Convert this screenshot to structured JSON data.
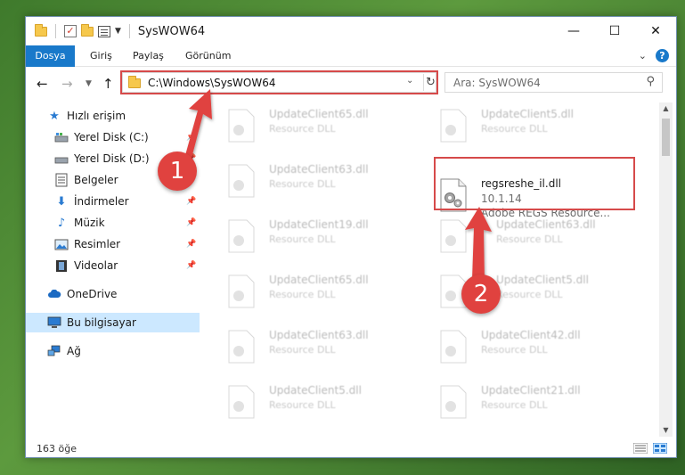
{
  "window": {
    "title": "SysWOW64",
    "buttons": {
      "minimize": "—",
      "maximize": "☐",
      "close": "✕"
    }
  },
  "ribbon": {
    "tabs": [
      "Dosya",
      "Giriş",
      "Paylaş",
      "Görünüm"
    ],
    "accent": "#1979ca"
  },
  "address": {
    "path": "C:\\Windows\\SysWOW64",
    "search_placeholder": "Ara: SysWOW64"
  },
  "nav": {
    "items": [
      {
        "label": "Hızlı erişim",
        "icon": "star-icon",
        "pinned": false
      },
      {
        "label": "Yerel Disk (C:)",
        "icon": "drive-icon",
        "pinned": true
      },
      {
        "label": "Yerel Disk (D:)",
        "icon": "drive-icon",
        "pinned": true
      },
      {
        "label": "Belgeler",
        "icon": "documents-icon",
        "pinned": true
      },
      {
        "label": "İndirmeler",
        "icon": "download-icon",
        "pinned": true
      },
      {
        "label": "Müzik",
        "icon": "music-icon",
        "pinned": true
      },
      {
        "label": "Resimler",
        "icon": "pictures-icon",
        "pinned": true
      },
      {
        "label": "Videolar",
        "icon": "videos-icon",
        "pinned": true
      },
      {
        "label": "OneDrive",
        "icon": "cloud-icon",
        "pinned": false
      },
      {
        "label": "Bu bilgisayar",
        "icon": "computer-icon",
        "pinned": false,
        "selected": true
      },
      {
        "label": "Ağ",
        "icon": "network-icon",
        "pinned": false
      }
    ]
  },
  "files": {
    "left": [
      {
        "name": "UpdateClient65.dll",
        "desc": "Resource DLL"
      },
      {
        "name": "UpdateClient63.dll",
        "desc": "Resource DLL"
      },
      {
        "name": "UpdateClient19.dll",
        "desc": "Resource DLL"
      },
      {
        "name": "UpdateClient65.dll",
        "desc": "Resource DLL"
      },
      {
        "name": "UpdateClient63.dll",
        "desc": "Resource DLL"
      },
      {
        "name": "UpdateClient5.dll",
        "desc": "Resource DLL"
      }
    ],
    "right": [
      {
        "name": "UpdateClient5.dll",
        "desc": "Resource DLL"
      },
      {
        "name": "UpdateClient63.dll",
        "desc": "Resource DLL"
      },
      {
        "name": "UpdateClient5.dll",
        "desc": "Resource DLL"
      },
      {
        "name": "UpdateClient42.dll",
        "desc": "Resource DLL"
      },
      {
        "name": "UpdateClient21.dll",
        "desc": "Resource DLL"
      }
    ],
    "highlighted": {
      "name": "regsreshe_il.dll",
      "version": "10.1.14",
      "desc": "Adobe REGS Resource..."
    }
  },
  "status": {
    "count": "163 öğe"
  },
  "callouts": {
    "one": "1",
    "two": "2",
    "color": "#e0423f"
  }
}
